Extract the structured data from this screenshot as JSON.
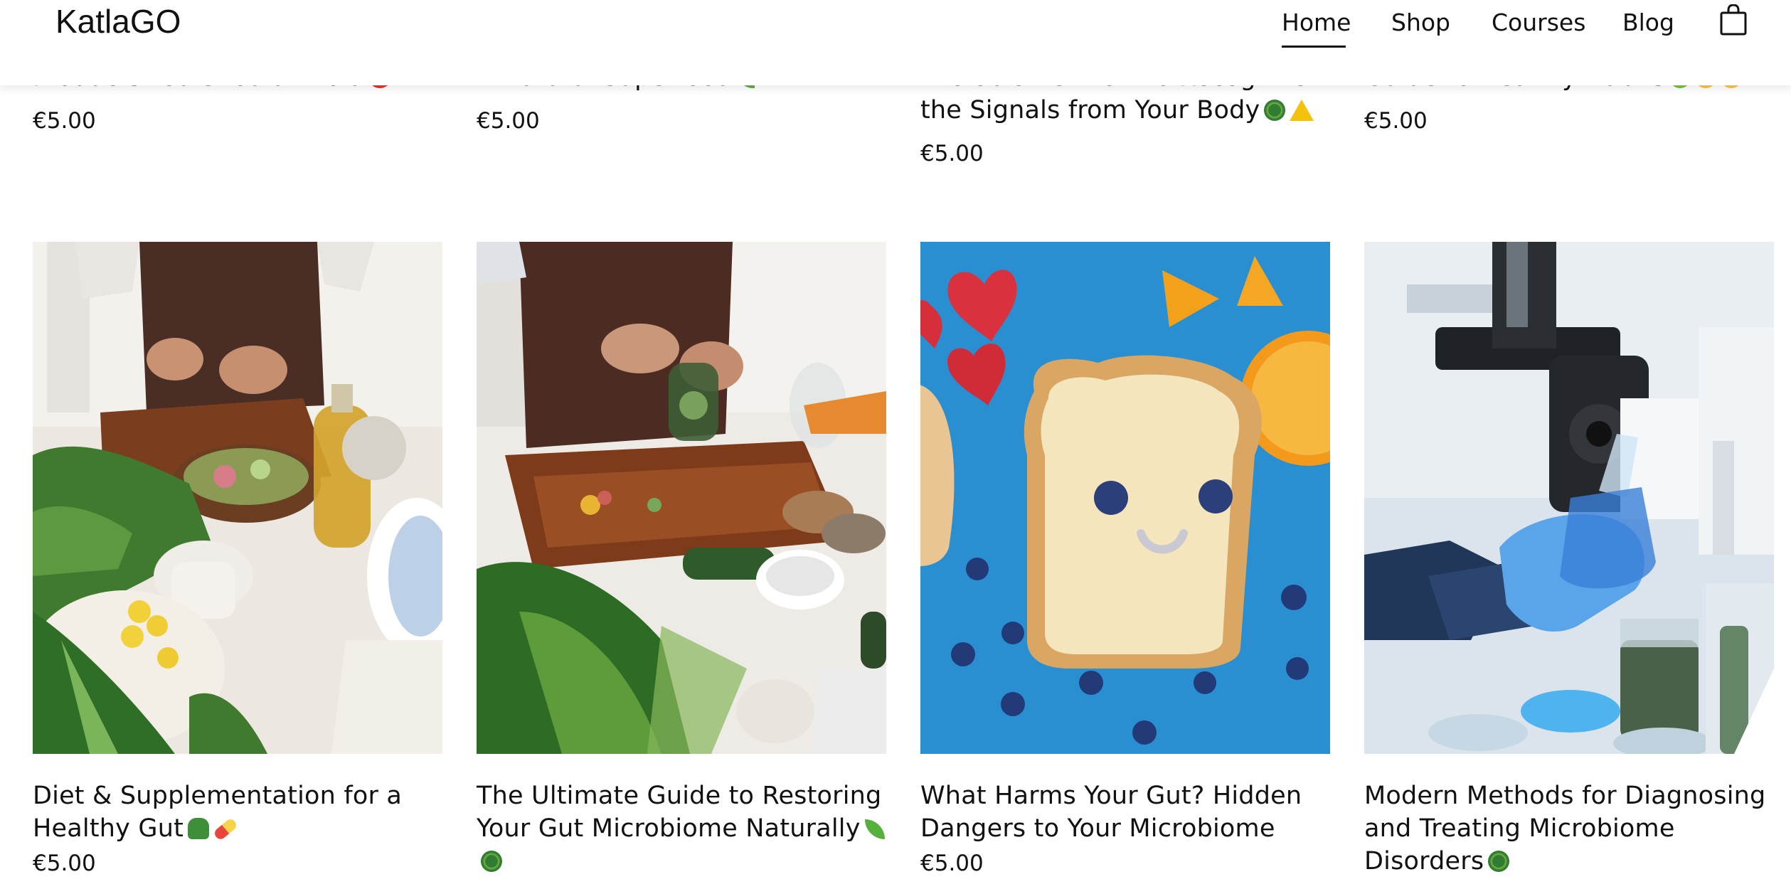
{
  "header": {
    "logo": "KatlaGO",
    "nav": [
      "Home",
      "Shop",
      "Courses",
      "Blog"
    ],
    "active_nav": "Home"
  },
  "top_row": [
    {
      "title": "Products You Should Avoid",
      "emoji": [
        "no-entry"
      ],
      "price": "€5.00"
    },
    {
      "title": "A Natural Superfood",
      "emoji": [
        "herb"
      ],
      "price": "€5.00"
    },
    {
      "title": "Microbiome: How to Recognize the Signals from Your Body",
      "emoji": [
        "microbe",
        "warning"
      ],
      "price": "€5.00"
    },
    {
      "title": "Guide to Healthy Habits",
      "emoji": [
        "green-apple",
        "child",
        "child"
      ],
      "price": "€5.00"
    }
  ],
  "products": [
    {
      "title": "Diet & Supplementation for a Healthy Gut",
      "emoji": [
        "broccoli",
        "pill"
      ],
      "price": "€5.00",
      "image": "hands-cutting-vegetables-photo"
    },
    {
      "title": "The Ultimate Guide to Restoring Your Gut Microbiome Naturally",
      "emoji": [
        "seedling",
        "microbe"
      ],
      "price": "",
      "image": "fermenting-vegetables-jar-photo"
    },
    {
      "title": "What Harms Your Gut? Hidden Dangers to Your Microbiome",
      "emoji": [],
      "price": "€5.00",
      "image": "smiling-bread-toast-photo"
    },
    {
      "title": "Modern Methods for Diagnosing and Treating Microbiome Disorders",
      "emoji": [
        "microbe"
      ],
      "price": "",
      "image": "lab-flask-microscope-photo"
    }
  ],
  "colors": {
    "text": "#111111",
    "background": "#ffffff",
    "toast_bg": "#2a8fd0"
  }
}
